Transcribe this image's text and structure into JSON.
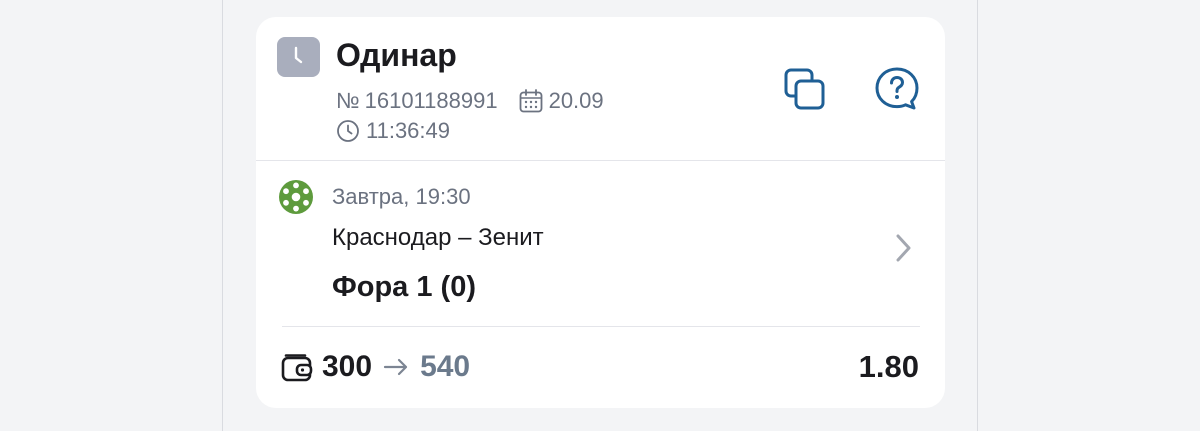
{
  "bet": {
    "type": "Одинар",
    "number_prefix": "№",
    "number": "16101188991",
    "date": "20.09",
    "time": "11:36:49",
    "status_icon": "clock-icon"
  },
  "actions": {
    "copy_icon": "copy-icon",
    "help_icon": "help-chat-icon"
  },
  "event": {
    "sport_icon": "soccer-ball-icon",
    "start": "Завтра, 19:30",
    "match": "Краснодар – Зенит",
    "market": "Фора 1 (0)"
  },
  "footer": {
    "stake": "300",
    "payout": "540",
    "odds": "1.80"
  },
  "colors": {
    "background": "#f3f4f6",
    "card": "#ffffff",
    "accent_blue": "#1f5f95",
    "muted_text": "#6b7280",
    "status_gray": "#a9aebd",
    "sport_green": "#5e9b3d",
    "payout_gray": "#6b7a8c"
  }
}
